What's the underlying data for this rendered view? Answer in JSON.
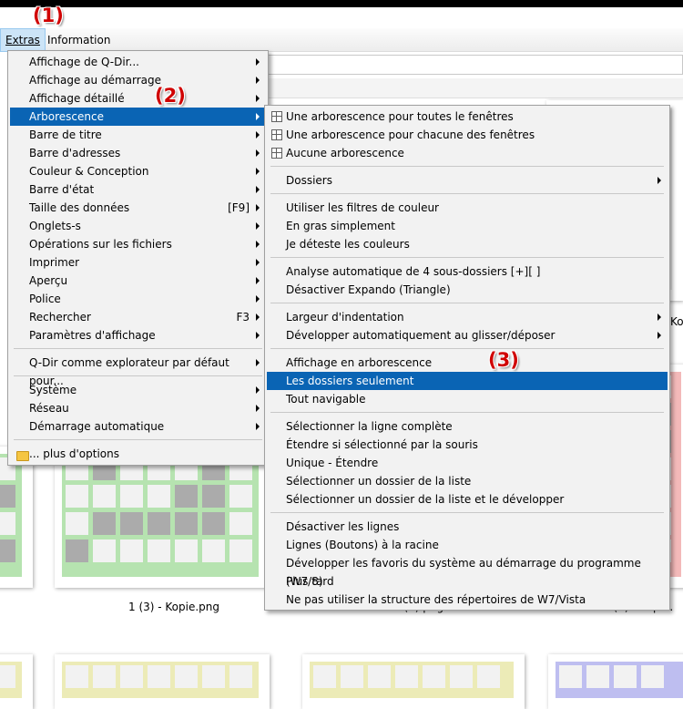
{
  "annotations": [
    "(1)",
    "(2)",
    "(3)"
  ],
  "menubar": {
    "items": [
      {
        "label": "Extras"
      },
      {
        "label": "Information"
      }
    ]
  },
  "main_menu": {
    "items": [
      {
        "label": "Affichage de Q-Dir...",
        "submenu": true
      },
      {
        "label": "Affichage au démarrage",
        "submenu": true
      },
      {
        "label": "Affichage détaillé",
        "submenu": true
      },
      {
        "label": "Arborescence",
        "submenu": true,
        "highlighted": true
      },
      {
        "label": "Barre de titre",
        "submenu": true
      },
      {
        "label": "Barre d'adresses",
        "submenu": true
      },
      {
        "label": "Couleur & Conception",
        "submenu": true
      },
      {
        "label": "Barre d'état",
        "submenu": true
      },
      {
        "label": "Taille des données",
        "shortcut": "[F9]",
        "submenu": true
      },
      {
        "label": "Onglets-s",
        "submenu": true
      },
      {
        "label": "Opérations sur les fichiers",
        "submenu": true
      },
      {
        "label": "Imprimer",
        "submenu": true
      },
      {
        "label": "Aperçu",
        "submenu": true
      },
      {
        "label": "Police",
        "submenu": true
      },
      {
        "label": "Rechercher",
        "shortcut": "F3",
        "submenu": true
      },
      {
        "label": "Paramètres d'affichage",
        "submenu": true
      },
      {
        "label": "Q-Dir comme explorateur par défaut pour...",
        "submenu": true
      },
      {
        "label": "Système",
        "submenu": true
      },
      {
        "label": "Réseau",
        "submenu": true
      },
      {
        "label": "Démarrage automatique",
        "submenu": true
      },
      {
        "label": "... plus d'options",
        "icon": "folder-icon"
      }
    ]
  },
  "sub_menu": {
    "items": [
      {
        "label": "Une arborescence pour toutes le fenêtres",
        "icon": "tree-icon"
      },
      {
        "label": "Une arborescence pour chacune des fenêtres",
        "icon": "tree-icon"
      },
      {
        "label": "Aucune arborescence",
        "icon": "tree-icon"
      },
      {
        "label": "Dossiers",
        "submenu": true
      },
      {
        "label": "Utiliser les filtres de couleur"
      },
      {
        "label": "En gras simplement"
      },
      {
        "label": "Je déteste les couleurs"
      },
      {
        "label": "Analyse automatique de 4 sous-dossiers [+][ ]"
      },
      {
        "label": "Désactiver Expando (Triangle)"
      },
      {
        "label": "Largeur d'indentation",
        "submenu": true
      },
      {
        "label": "Développer automatiquement au glisser/déposer",
        "submenu": true
      },
      {
        "label": "Affichage en arborescence"
      },
      {
        "label": "Les dossiers seulement",
        "highlighted": true
      },
      {
        "label": "Tout navigable"
      },
      {
        "label": "Sélectionner la ligne complète"
      },
      {
        "label": "Étendre si sélectionné par la souris"
      },
      {
        "label": "Unique - Étendre"
      },
      {
        "label": "Sélectionner un dossier de la liste"
      },
      {
        "label": "Sélectionner un dossier de la liste et le développer"
      },
      {
        "label": "Désactiver les lignes"
      },
      {
        "label": "Lignes (Boutons) à la racine"
      },
      {
        "label": "Développer les favoris du système au démarrage du programme (W7/8)"
      },
      {
        "label": "Plus tard"
      },
      {
        "label": "Ne pas utiliser la structure des répertoires de W7/Vista"
      }
    ]
  },
  "background": {
    "captions": [
      "1 (3) - Kopie.png",
      "1 (3).png",
      "1 (4) - Kopie.",
      "Ko"
    ]
  },
  "colors": {
    "highlight": "#0a64b4",
    "thumb_green": "#b6e3b0",
    "thumb_red": "#f3b9b9",
    "thumb_yellow": "#ecebb7",
    "thumb_blue": "#bebef0",
    "annotation_red": "#d00000"
  }
}
